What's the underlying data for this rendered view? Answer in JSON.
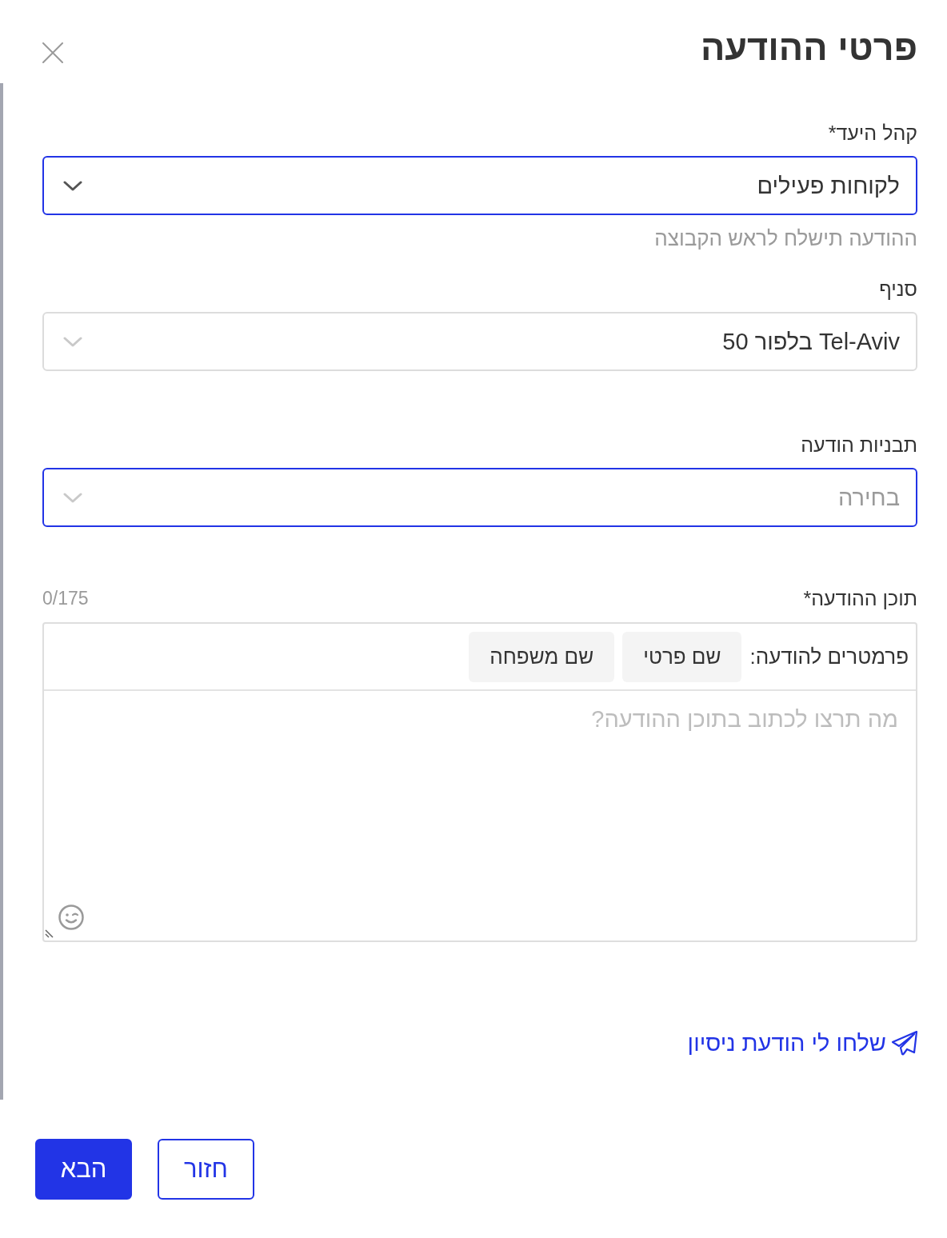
{
  "dialog": {
    "title": "פרטי ההודעה"
  },
  "fields": [
    {
      "kind": "select",
      "label": "קהל היעד*",
      "value": "לקוחות פעילים",
      "disabled": false,
      "hint": "ההודעה תישלח לראש הקבוצה"
    },
    {
      "kind": "select",
      "label": "סניף",
      "value": "Tel-Aviv בלפור 50",
      "disabled": true
    },
    {
      "kind": "select",
      "label": "תבניות הודעה",
      "placeholder": "בחירה",
      "disabled": false
    }
  ],
  "message": {
    "label": "תוכן ההודעה*",
    "counter": "0/175",
    "parameters_label": "פרמטרים להודעה:",
    "parameters": [
      "שם פרטי",
      "שם משפחה"
    ],
    "placeholder": "מה תרצו לכתוב בתוכן ההודעה?"
  },
  "test_link": "שלחו לי הודעת ניסיון",
  "buttons": [
    {
      "label": "חזור",
      "kind": "secondary"
    },
    {
      "label": "הבא",
      "kind": "primary"
    }
  ]
}
